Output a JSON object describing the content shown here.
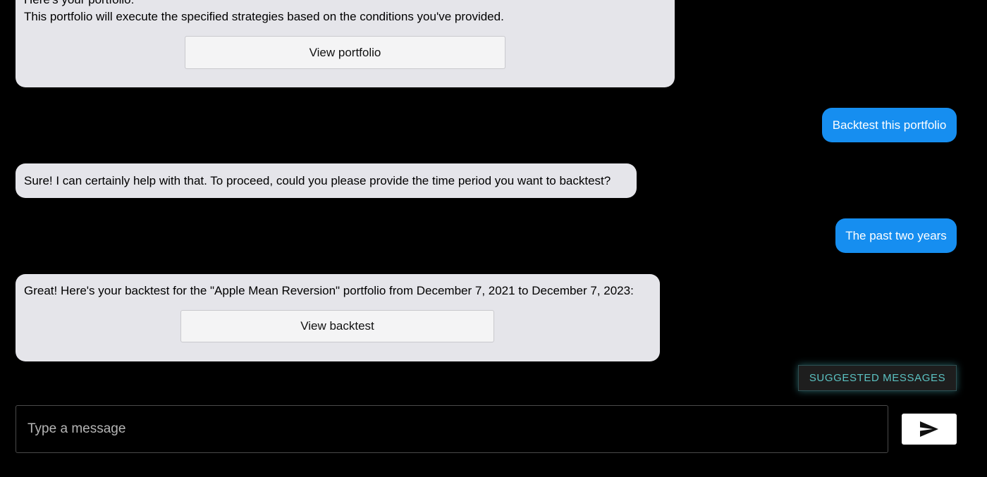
{
  "chat": {
    "messages": [
      {
        "sender": "bot",
        "lines": [
          "Here's your portfolio:",
          "This portfolio will execute the specified strategies based on the conditions you've provided."
        ],
        "button_label": "View portfolio"
      },
      {
        "sender": "user",
        "text": "Backtest this portfolio"
      },
      {
        "sender": "bot",
        "text": "Sure! I can certainly help with that. To proceed, could you please provide the time period you want to backtest?"
      },
      {
        "sender": "user",
        "text": "The past two years"
      },
      {
        "sender": "bot",
        "text": "Great! Here's your backtest for the \"Apple Mean Reversion\" portfolio from December 7, 2021 to December 7, 2023:",
        "button_label": "View backtest"
      }
    ]
  },
  "suggested_messages_label": "SUGGESTED MESSAGES",
  "composer": {
    "placeholder": "Type a message",
    "send_icon": "send-icon"
  },
  "colors": {
    "background": "#000000",
    "bot_bubble": "#e5e5ea",
    "user_bubble": "#168ef0",
    "suggested_text": "#5bc2c2"
  }
}
